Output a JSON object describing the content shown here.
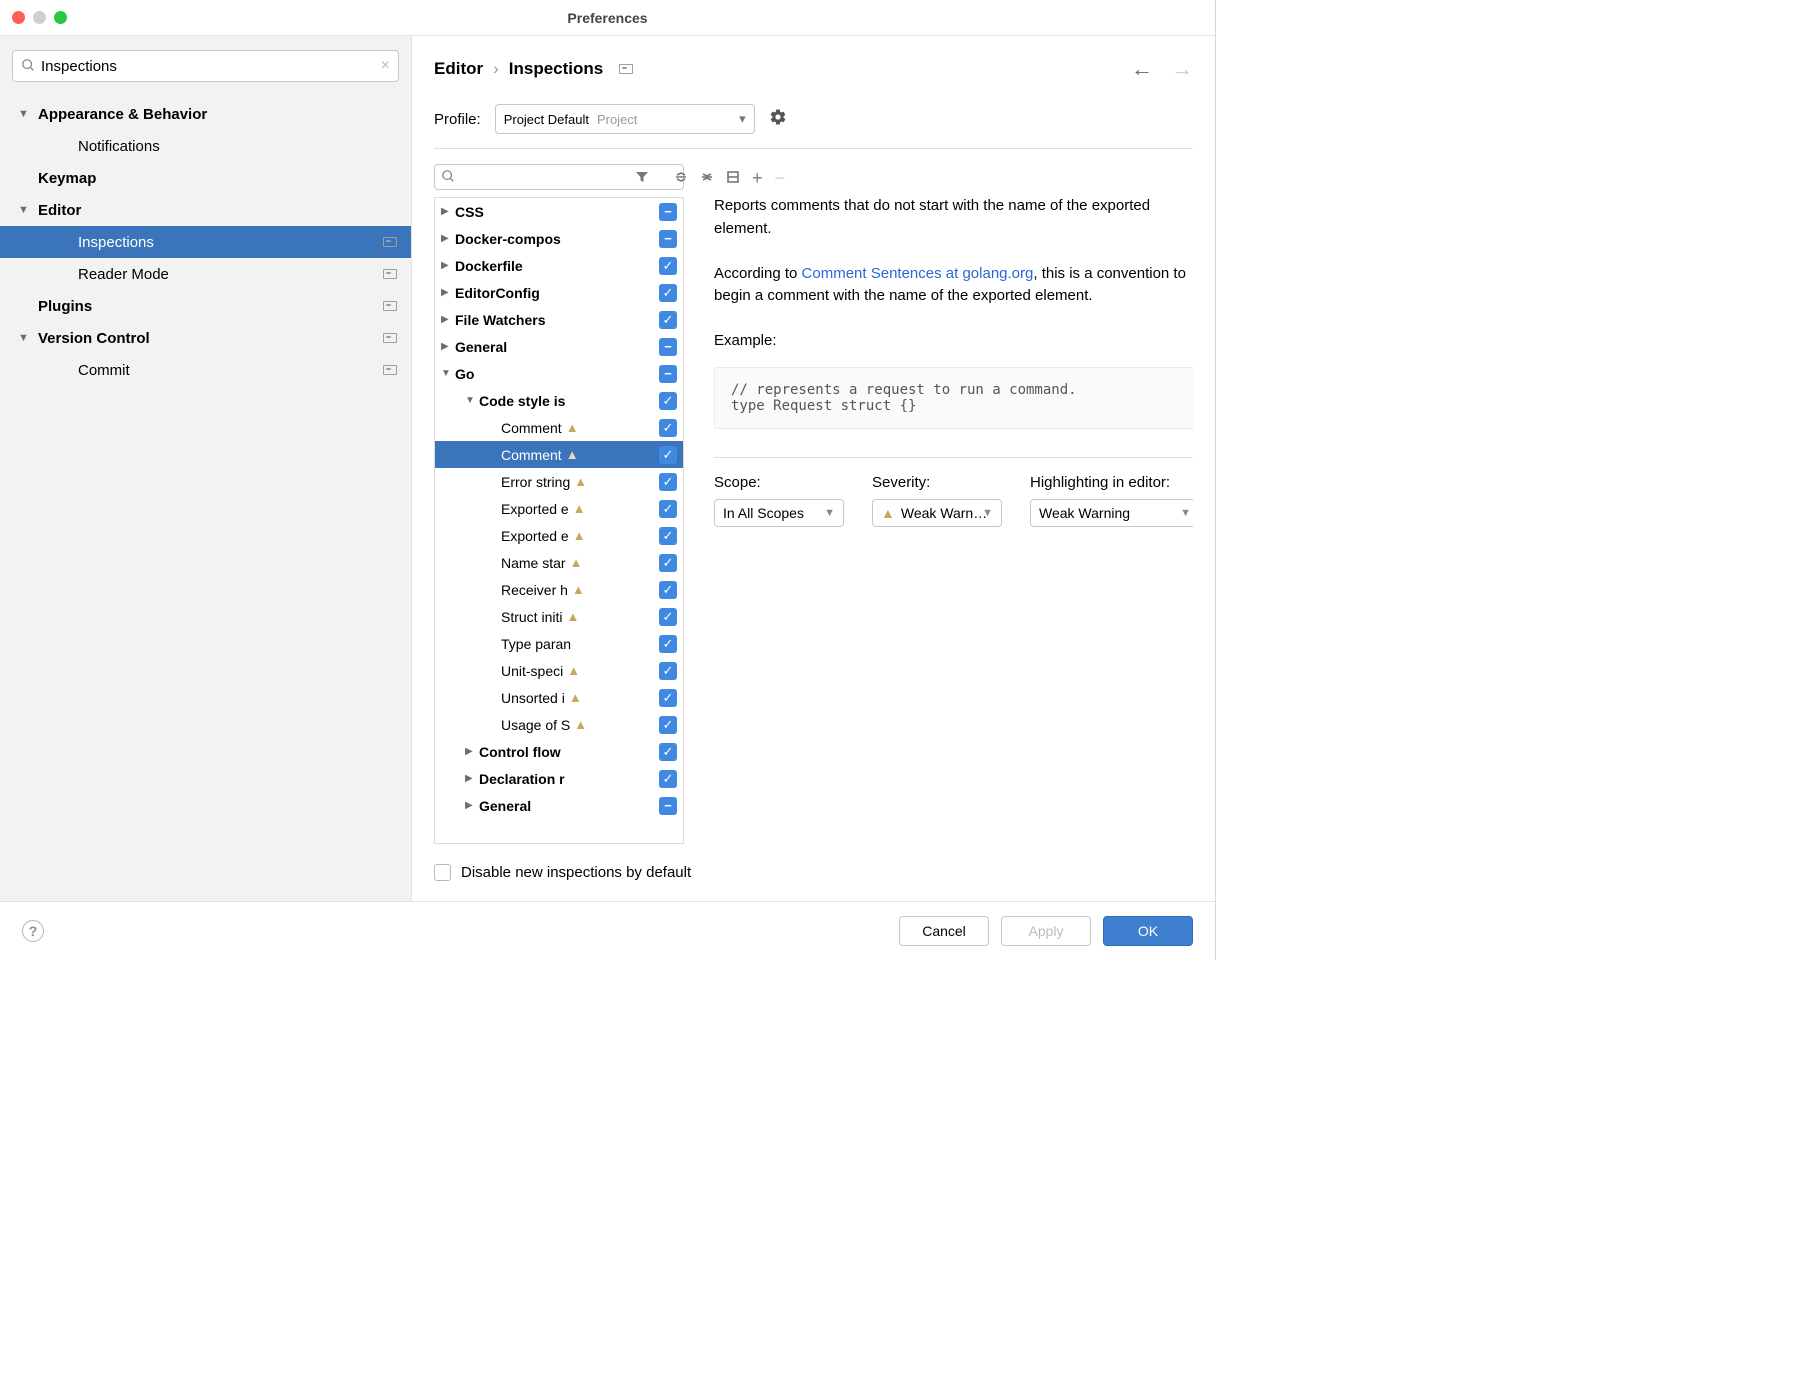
{
  "title": "Preferences",
  "sidebar": {
    "search_value": "Inspections",
    "items": [
      {
        "label": "Appearance & Behavior",
        "bold": true,
        "chev": "down",
        "indent": 0
      },
      {
        "label": "Notifications",
        "bold": false,
        "chev": "",
        "indent": 1
      },
      {
        "label": "Keymap",
        "bold": true,
        "chev": "",
        "indent": 0
      },
      {
        "label": "Editor",
        "bold": true,
        "chev": "down",
        "indent": 0
      },
      {
        "label": "Inspections",
        "bold": false,
        "chev": "",
        "indent": 1,
        "selected": true,
        "badge": true
      },
      {
        "label": "Reader Mode",
        "bold": false,
        "chev": "",
        "indent": 1,
        "badge": true
      },
      {
        "label": "Plugins",
        "bold": true,
        "chev": "",
        "indent": 0,
        "badge": true
      },
      {
        "label": "Version Control",
        "bold": true,
        "chev": "down",
        "indent": 0,
        "badge": true
      },
      {
        "label": "Commit",
        "bold": false,
        "chev": "",
        "indent": 1,
        "badge": true
      }
    ]
  },
  "breadcrumb": {
    "a": "Editor",
    "b": "Inspections"
  },
  "profile": {
    "label": "Profile:",
    "value": "Project Default",
    "scope": "Project"
  },
  "insp_tree": [
    {
      "label": "CSS",
      "bold": true,
      "chev": "right",
      "pad": 0,
      "state": "mixed"
    },
    {
      "label": "Docker-compos",
      "bold": true,
      "chev": "right",
      "pad": 0,
      "state": "mixed"
    },
    {
      "label": "Dockerfile",
      "bold": true,
      "chev": "right",
      "pad": 0,
      "state": "on"
    },
    {
      "label": "EditorConfig",
      "bold": true,
      "chev": "right",
      "pad": 0,
      "state": "on"
    },
    {
      "label": "File Watchers",
      "bold": true,
      "chev": "right",
      "pad": 0,
      "state": "on"
    },
    {
      "label": "General",
      "bold": true,
      "chev": "right",
      "pad": 0,
      "state": "mixed"
    },
    {
      "label": "Go",
      "bold": true,
      "chev": "down",
      "pad": 0,
      "state": "mixed"
    },
    {
      "label": "Code style is",
      "bold": true,
      "chev": "down",
      "pad": 1,
      "state": "on"
    },
    {
      "label": "Comment",
      "bold": false,
      "chev": "",
      "pad": 2,
      "state": "on",
      "warn": true
    },
    {
      "label": "Comment",
      "bold": false,
      "chev": "",
      "pad": 2,
      "state": "on",
      "warn": true,
      "selected": true
    },
    {
      "label": "Error string",
      "bold": false,
      "chev": "",
      "pad": 2,
      "state": "on",
      "warn": true
    },
    {
      "label": "Exported e",
      "bold": false,
      "chev": "",
      "pad": 2,
      "state": "on",
      "warn": true
    },
    {
      "label": "Exported e",
      "bold": false,
      "chev": "",
      "pad": 2,
      "state": "on",
      "warn": true
    },
    {
      "label": "Name star",
      "bold": false,
      "chev": "",
      "pad": 2,
      "state": "on",
      "warn": true
    },
    {
      "label": "Receiver h",
      "bold": false,
      "chev": "",
      "pad": 2,
      "state": "on",
      "warn": true
    },
    {
      "label": "Struct initi",
      "bold": false,
      "chev": "",
      "pad": 2,
      "state": "on",
      "warn": true
    },
    {
      "label": "Type paran",
      "bold": false,
      "chev": "",
      "pad": 2,
      "state": "on"
    },
    {
      "label": "Unit-speci",
      "bold": false,
      "chev": "",
      "pad": 2,
      "state": "on",
      "warn": true
    },
    {
      "label": "Unsorted i",
      "bold": false,
      "chev": "",
      "pad": 2,
      "state": "on",
      "warn": true
    },
    {
      "label": "Usage of S",
      "bold": false,
      "chev": "",
      "pad": 2,
      "state": "on",
      "warn": true
    },
    {
      "label": "Control flow",
      "bold": true,
      "chev": "right",
      "pad": 1,
      "state": "on"
    },
    {
      "label": "Declaration r",
      "bold": true,
      "chev": "right",
      "pad": 1,
      "state": "on"
    },
    {
      "label": "General",
      "bold": true,
      "chev": "right",
      "pad": 1,
      "state": "mixed"
    }
  ],
  "description": {
    "p1": "Reports comments that do not start with the name of the exported element.",
    "p2a": "According to ",
    "p2link": "Comment Sentences at golang.org",
    "p2b": ", this is a convention to begin a comment with the name of the exported element.",
    "example_label": "Example:",
    "code": "// represents a request to run a command.\ntype Request struct {}"
  },
  "options": {
    "scope_label": "Scope:",
    "scope_value": "In All Scopes",
    "sev_label": "Severity:",
    "sev_value": "Weak Warn…",
    "hl_label": "Highlighting in editor:",
    "hl_value": "Weak Warning"
  },
  "disable_label": "Disable new inspections by default",
  "buttons": {
    "cancel": "Cancel",
    "apply": "Apply",
    "ok": "OK"
  }
}
